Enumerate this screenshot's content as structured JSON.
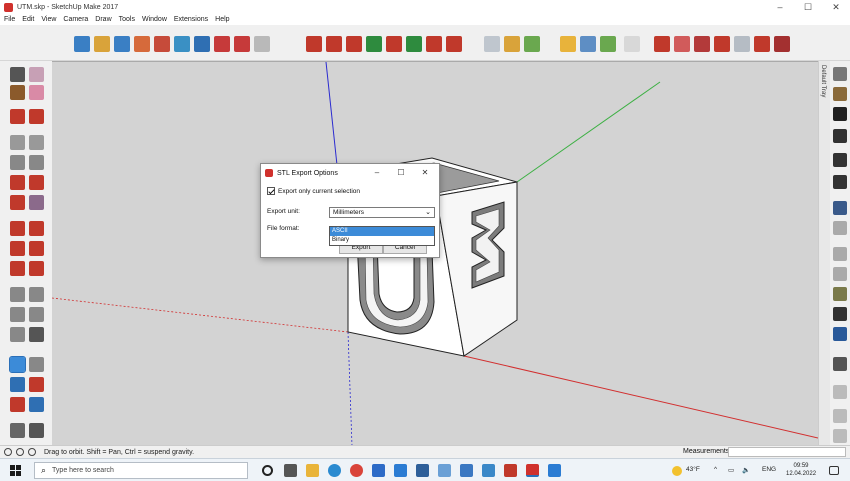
{
  "window": {
    "title": "UTM.skp - SketchUp Make 2017",
    "controls": [
      "–",
      "☐",
      "✕"
    ]
  },
  "menu": [
    "File",
    "Edit",
    "View",
    "Camera",
    "Draw",
    "Tools",
    "Window",
    "Extensions",
    "Help"
  ],
  "tray": {
    "label": "Default Tray"
  },
  "model_letters": {
    "front": "U",
    "side": "M"
  },
  "dialog": {
    "title": "STL Export Options",
    "controls": [
      "–",
      "☐",
      "✕"
    ],
    "checkbox_label": "Export only current selection",
    "checkbox_checked": true,
    "unit_label": "Export unit:",
    "unit_value": "Millimeters",
    "format_label": "File format:",
    "format_options": [
      "ASCII",
      "Binary"
    ],
    "format_selected": "ASCII",
    "export_button": "Export",
    "cancel_button": "Cancel"
  },
  "status": {
    "message": "Drag to orbit. Shift = Pan, Ctrl = suspend gravity.",
    "measurements_label": "Measurements"
  },
  "taskbar": {
    "search_placeholder": "Type here to search",
    "temperature": "43°F",
    "language": "ENG",
    "time": "09:59",
    "date": "12.04.2022"
  },
  "colors": {
    "axis_red": "#d22f2f",
    "axis_green": "#3cb043",
    "axis_blue": "#2b2bd0",
    "selection_blue": "#3c8bd8",
    "app_red": "#d0312d"
  }
}
